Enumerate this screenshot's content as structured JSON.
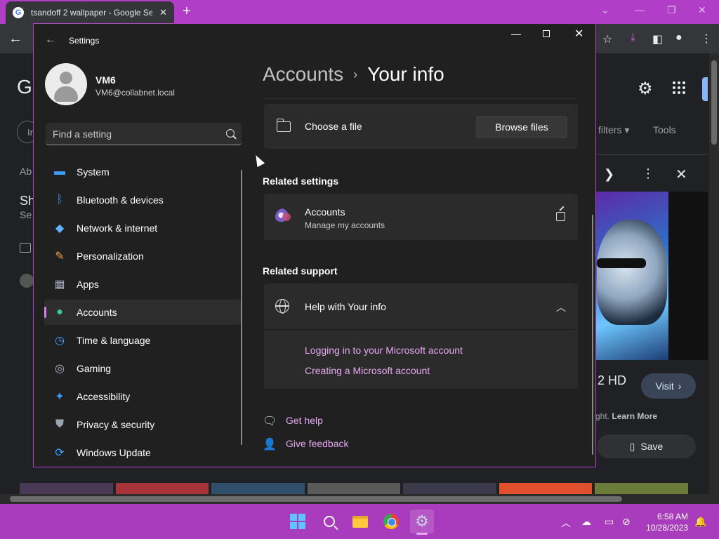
{
  "browser": {
    "tab_title": "tsandoff 2 wallpaper - Google Se",
    "tab_favicon": "G",
    "filters_label": "filters",
    "tools_label": "Tools",
    "result_title": "2 HD",
    "result_sub": "ght.",
    "learn_more": "Learn More",
    "visit_label": "Visit",
    "save_label": "Save",
    "peek": {
      "logo_letter": "G",
      "nav_fragment": "Ir",
      "about_fragment": "Ab",
      "sh_fragment": "Sh",
      "se_fragment": "Se"
    }
  },
  "settings": {
    "app_title": "Settings",
    "user": {
      "name": "VM6",
      "email": "VM6@collabnet.local"
    },
    "search_placeholder": "Find a setting",
    "nav": [
      {
        "label": "System",
        "icon": "monitor-icon",
        "color": "#3aa0ff"
      },
      {
        "label": "Bluetooth & devices",
        "icon": "bluetooth-icon",
        "color": "#3a8bff"
      },
      {
        "label": "Network & internet",
        "icon": "wifi-icon",
        "color": "#5fb4ff"
      },
      {
        "label": "Personalization",
        "icon": "brush-icon",
        "color": "#f0a050"
      },
      {
        "label": "Apps",
        "icon": "apps-icon",
        "color": "#a0a8b8"
      },
      {
        "label": "Accounts",
        "icon": "person-icon",
        "color": "#37c8a0"
      },
      {
        "label": "Time & language",
        "icon": "clock-globe-icon",
        "color": "#3aa0ff"
      },
      {
        "label": "Gaming",
        "icon": "gamepad-icon",
        "color": "#b0b8c8"
      },
      {
        "label": "Accessibility",
        "icon": "accessibility-icon",
        "color": "#3a9bff"
      },
      {
        "label": "Privacy & security",
        "icon": "shield-icon",
        "color": "#9aa3b0"
      },
      {
        "label": "Windows Update",
        "icon": "update-icon",
        "color": "#3aa0ff"
      }
    ],
    "active_nav": "Accounts",
    "breadcrumb": {
      "parent": "Accounts",
      "separator": "›",
      "current": "Your info"
    },
    "choose_file_label": "Choose a file",
    "browse_files_label": "Browse files",
    "related_settings_title": "Related settings",
    "accounts_link": {
      "title": "Accounts",
      "subtitle": "Manage my accounts"
    },
    "related_support_title": "Related support",
    "help": {
      "title": "Help with Your info",
      "links": [
        "Logging in to your Microsoft account",
        "Creating a Microsoft account"
      ]
    },
    "get_help": "Get help",
    "give_feedback": "Give feedback"
  },
  "taskbar": {
    "time": "6:58 AM",
    "date": "10/28/2023"
  },
  "colors": {
    "accent": "#b03ec6",
    "link": "#e7a7f3",
    "taskbar": "#a93bbd"
  }
}
